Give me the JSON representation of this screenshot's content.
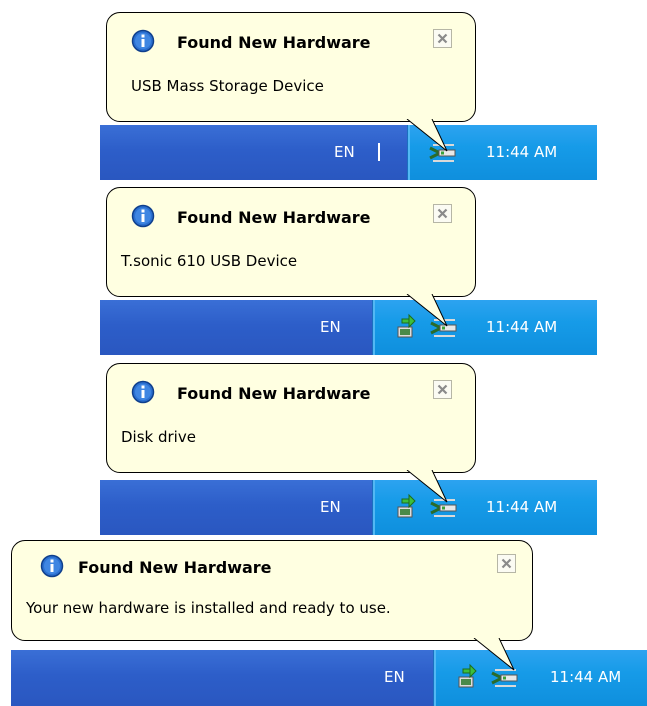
{
  "notifications": [
    {
      "title": "Found New Hardware",
      "message": "USB Mass Storage Device",
      "tray_lang": "EN",
      "clock": "11:44 AM",
      "tray_icons": [
        "safely-remove-hardware-icon"
      ]
    },
    {
      "title": "Found New Hardware",
      "message": "T.sonic 610 USB Device",
      "tray_lang": "EN",
      "clock": "11:44 AM",
      "tray_icons": [
        "network-connection-icon",
        "safely-remove-hardware-icon"
      ]
    },
    {
      "title": "Found New Hardware",
      "message": "Disk drive",
      "tray_lang": "EN",
      "clock": "11:44 AM",
      "tray_icons": [
        "network-connection-icon",
        "safely-remove-hardware-icon"
      ]
    },
    {
      "title": "Found New Hardware",
      "message": "Your new hardware is installed and ready to use.",
      "tray_lang": "EN",
      "clock": "11:44 AM",
      "tray_icons": [
        "network-connection-icon",
        "safely-remove-hardware-icon"
      ]
    }
  ],
  "colors": {
    "taskbar": "#2d5ec9",
    "tray": "#169be8",
    "balloon": "#ffffe1",
    "info_icon": "#1f5fbf"
  }
}
